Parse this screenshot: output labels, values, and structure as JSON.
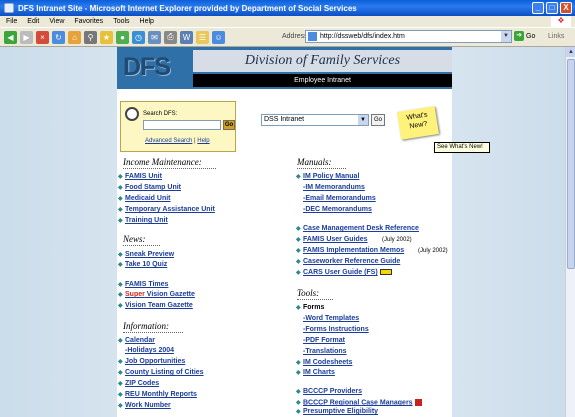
{
  "window": {
    "title": "DFS Intranet Site - Microsoft Internet Explorer provided by Department of Social Services",
    "buttons": [
      "_",
      "□",
      "X"
    ]
  },
  "menu": [
    "File",
    "Edit",
    "View",
    "Favorites",
    "Tools",
    "Help"
  ],
  "toolbar": {
    "back_label": "",
    "address_label": "Address",
    "address_value": "http://dssweb/dfs/index.htm",
    "go_label": "Go",
    "links_label": "Links"
  },
  "banner": {
    "logo": "DFS",
    "title": "Division of Family Services",
    "subtitle": "Employee Intranet"
  },
  "search": {
    "label": "Search DFS:",
    "go": "Go",
    "advanced": "Advanced Search",
    "separator": "|",
    "help": "Help"
  },
  "site_select": {
    "value": "DSS Intranet",
    "go": "Go"
  },
  "whats_new": {
    "label": "What's New?",
    "tooltip": "See What's New!"
  },
  "left": {
    "income_heading": "Income Maintenance:",
    "income": [
      "FAMIS Unit",
      "Food Stamp Unit",
      "Medicaid Unit",
      "Temporary Assistance Unit",
      "Training Unit"
    ],
    "news_heading": "News:",
    "news": [
      "Sneak Preview",
      "Take 10 Quiz"
    ],
    "famis_times": "FAMIS Times",
    "gazette_super": "Super",
    "gazette_rest": " Vision Gazette",
    "vision_team": "Vision Team Gazette",
    "info_heading": "Information:",
    "calendar": "Calendar",
    "holidays": "-Holidays 2004",
    "info": [
      "Job Opportunities",
      "County Listing of Cities",
      "ZIP Codes",
      "REU Monthly Reports",
      "Work Number"
    ]
  },
  "right": {
    "manuals_heading": "Manuals:",
    "im_policy": "IM Policy Manual",
    "im_memos": "-IM Memorandums",
    "email_memos": "-Email Memorandums",
    "dec_memos": "-DEC Memorandums",
    "case_mgmt": "Case Management Desk Reference",
    "famis_guides": "FAMIS User Guides",
    "famis_guides_note": "(July 2002)",
    "famis_memos": "FAMIS Implementation Memos",
    "famis_memos_note": "(July 2002)",
    "caseworker": "Caseworker Reference Guide",
    "cars": "CARS User Guide (FS)",
    "tools_heading": "Tools:",
    "forms": "Forms",
    "word_templates": "-Word Templates",
    "forms_instructions": "-Forms Instructions",
    "pdf_format": "-PDF Format",
    "translations": "-Translations",
    "codesheets": "IM Codesheets",
    "charts": "IM Charts",
    "bcccp_providers": "BCCCP Providers",
    "bcccp_managers": "BCCCP Regional Case Managers",
    "presumptive": "Presumptive Eligibility"
  }
}
